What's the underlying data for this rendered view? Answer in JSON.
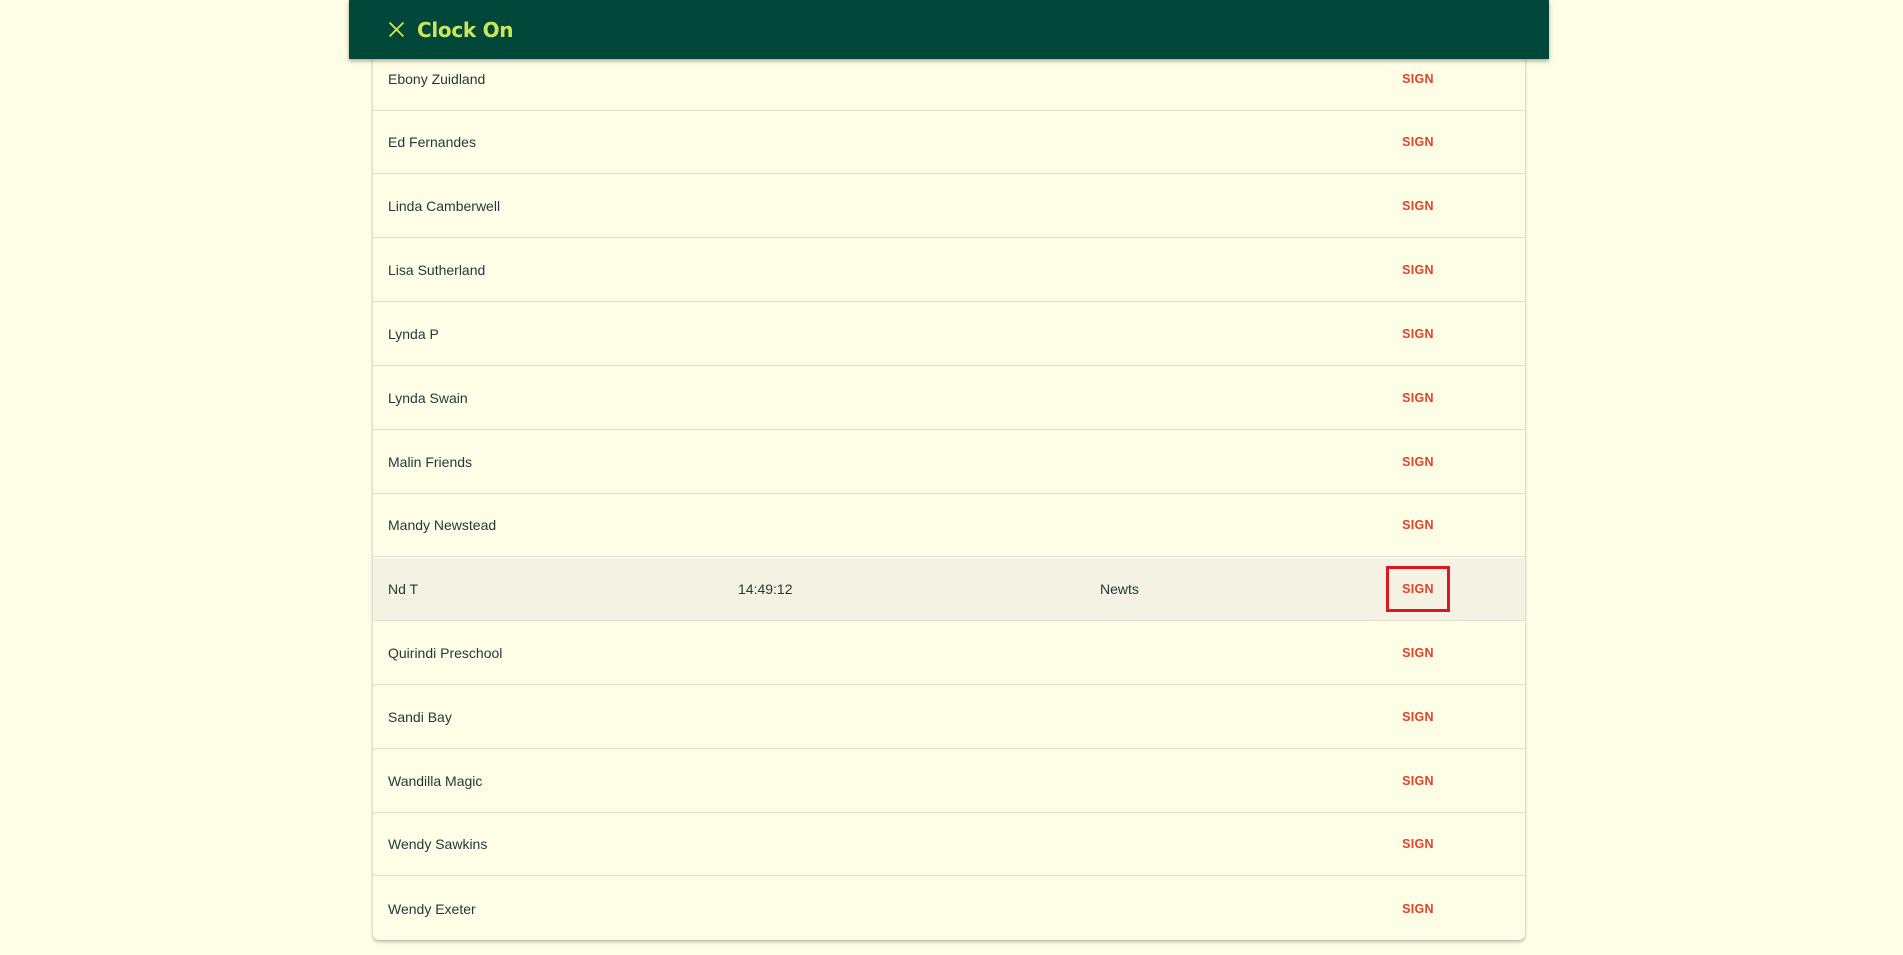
{
  "header": {
    "title": "Clock On",
    "close_icon": "close-icon",
    "background_color": "#01473a",
    "title_color": "#cbe65a"
  },
  "list": {
    "sign_color": "#e2432c",
    "rows": [
      {
        "name": "Ebony Zuidland",
        "time": "",
        "group": "",
        "action": "SIGN",
        "highlighted": false
      },
      {
        "name": "Ed Fernandes",
        "time": "",
        "group": "",
        "action": "SIGN",
        "highlighted": false
      },
      {
        "name": "Linda Camberwell",
        "time": "",
        "group": "",
        "action": "SIGN",
        "highlighted": false
      },
      {
        "name": "Lisa Sutherland",
        "time": "",
        "group": "",
        "action": "SIGN",
        "highlighted": false
      },
      {
        "name": "Lynda P",
        "time": "",
        "group": "",
        "action": "SIGN",
        "highlighted": false
      },
      {
        "name": "Lynda Swain",
        "time": "",
        "group": "",
        "action": "SIGN",
        "highlighted": false
      },
      {
        "name": "Malin Friends",
        "time": "",
        "group": "",
        "action": "SIGN",
        "highlighted": false
      },
      {
        "name": "Mandy Newstead",
        "time": "",
        "group": "",
        "action": "SIGN",
        "highlighted": false
      },
      {
        "name": "Nd T",
        "time": "14:49:12",
        "group": "Newts",
        "action": "SIGN",
        "highlighted": true
      },
      {
        "name": "Quirindi Preschool",
        "time": "",
        "group": "",
        "action": "SIGN",
        "highlighted": false
      },
      {
        "name": "Sandi Bay",
        "time": "",
        "group": "",
        "action": "SIGN",
        "highlighted": false
      },
      {
        "name": "Wandilla Magic",
        "time": "",
        "group": "",
        "action": "SIGN",
        "highlighted": false
      },
      {
        "name": "Wendy Sawkins",
        "time": "",
        "group": "",
        "action": "SIGN",
        "highlighted": false
      },
      {
        "name": "Wendy Exeter",
        "time": "",
        "group": "",
        "action": "SIGN",
        "highlighted": false
      }
    ]
  }
}
